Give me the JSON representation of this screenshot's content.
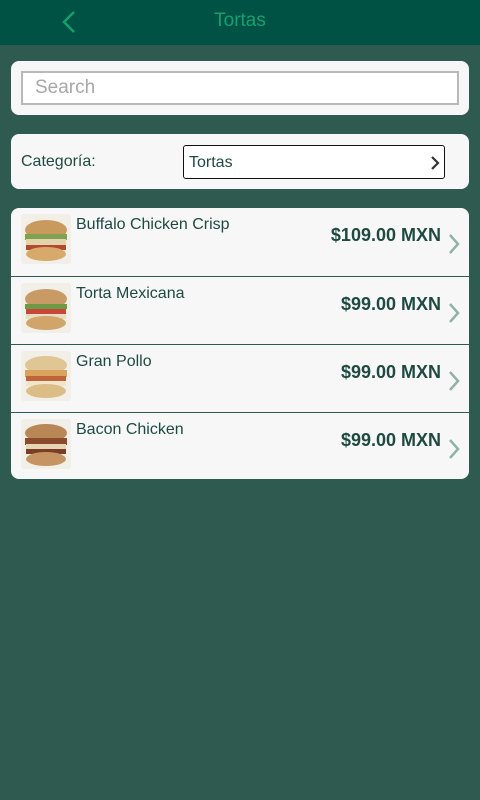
{
  "header": {
    "title": "Tortas",
    "back_icon": "chevron-left-icon"
  },
  "search": {
    "placeholder": "Search",
    "value": ""
  },
  "category": {
    "label": "Categoría:",
    "selected": "Tortas"
  },
  "items": [
    {
      "name": "Buffalo Chicken Crisp",
      "price": "$109.00 MXN"
    },
    {
      "name": "Torta Mexicana",
      "price": "$99.00 MXN"
    },
    {
      "name": "Gran Pollo",
      "price": "$99.00 MXN"
    },
    {
      "name": "Bacon Chicken",
      "price": "$99.00 MXN"
    }
  ],
  "colors": {
    "header_bg": "#005245",
    "header_text": "#16a06d",
    "page_bg": "#2f5a4f",
    "card_bg": "#f7f7f7",
    "text": "#1e4a40",
    "chevron": "#8fb3a7"
  }
}
